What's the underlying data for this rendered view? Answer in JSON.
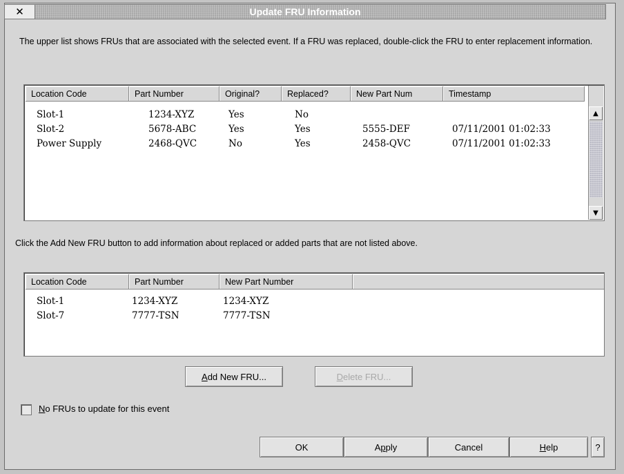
{
  "window": {
    "title": "Update FRU Information",
    "close_label": "✕"
  },
  "instructions": {
    "upper": "The upper list shows FRUs that are associated with the selected event.  If a FRU was replaced, double-click the FRU to enter replacement information.",
    "lower": "Click the Add New FRU button to add information about replaced or added parts that are not listed above."
  },
  "upper_list": {
    "columns": [
      "Location Code",
      "Part Number",
      "Original?",
      "Replaced?",
      "New Part Num",
      "Timestamp"
    ],
    "rows": [
      {
        "location": "Slot-1",
        "part": "1234-XYZ",
        "original": "Yes",
        "replaced": "No",
        "new_part": "",
        "timestamp": ""
      },
      {
        "location": "Slot-2",
        "part": "5678-ABC",
        "original": "Yes",
        "replaced": "Yes",
        "new_part": "5555-DEF",
        "timestamp": "07/11/2001 01:02:33"
      },
      {
        "location": "Power Supply",
        "part": "2468-QVC",
        "original": "No",
        "replaced": "Yes",
        "new_part": "2458-QVC",
        "timestamp": "07/11/2001 01:02:33"
      }
    ]
  },
  "lower_list": {
    "columns": [
      "Location Code",
      "Part Number",
      "New Part Number"
    ],
    "rows": [
      {
        "location": "Slot-1",
        "part": "1234-XYZ",
        "new_part": "1234-XYZ"
      },
      {
        "location": "Slot-7",
        "part": "7777-TSN",
        "new_part": "7777-TSN"
      }
    ]
  },
  "buttons": {
    "add_new_fru": {
      "mnemonic": "A",
      "rest": "dd New FRU..."
    },
    "delete_fru": {
      "mnemonic": "D",
      "rest": "elete FRU..."
    },
    "ok": "OK",
    "apply": {
      "pre": "A",
      "mnemonic": "p",
      "rest": "ply"
    },
    "cancel": "Cancel",
    "help": {
      "mnemonic": "H",
      "rest": "elp"
    },
    "context_help": "?"
  },
  "checkbox": {
    "mnemonic": "N",
    "rest": "o FRUs to update for this event",
    "checked": false
  }
}
